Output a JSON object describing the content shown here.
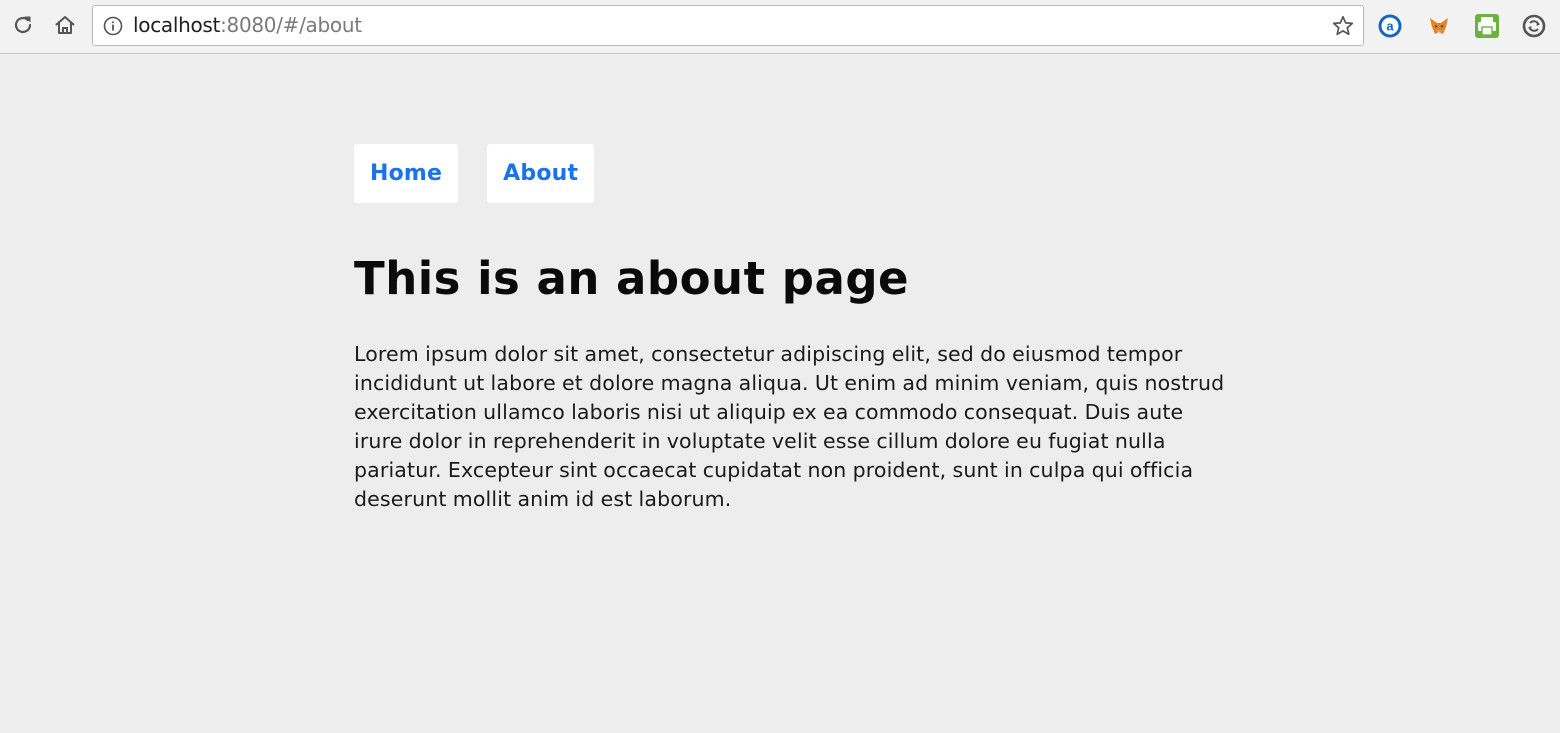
{
  "browser": {
    "url_host": "localhost",
    "url_rest": ":8080/#/about",
    "icons": {
      "reload": "reload-icon",
      "home": "home-icon",
      "info": "info-icon",
      "bookmark": "star-icon",
      "extensions": [
        "amazon-extension-icon",
        "metamask-extension-icon",
        "print-extension-icon",
        "sync-extension-icon"
      ]
    }
  },
  "nav": {
    "items": [
      {
        "label": "Home"
      },
      {
        "label": "About"
      }
    ],
    "link_color": "#1a73e8"
  },
  "page": {
    "title": "This is an about page",
    "body": "Lorem ipsum dolor sit amet, consectetur adipiscing elit, sed do eiusmod tempor incididunt ut labore et dolore magna aliqua. Ut enim ad minim veniam, quis nostrud exercitation ullamco laboris nisi ut aliquip ex ea commodo consequat. Duis aute irure dolor in reprehenderit in voluptate velit esse cillum dolore eu fugiat nulla pariatur. Excepteur sint occaecat cupidatat non proident, sunt in culpa qui officia deserunt mollit anim id est laborum."
  },
  "colors": {
    "background": "#ededed",
    "link": "#1a73e8",
    "text": "#0a0a0a"
  }
}
